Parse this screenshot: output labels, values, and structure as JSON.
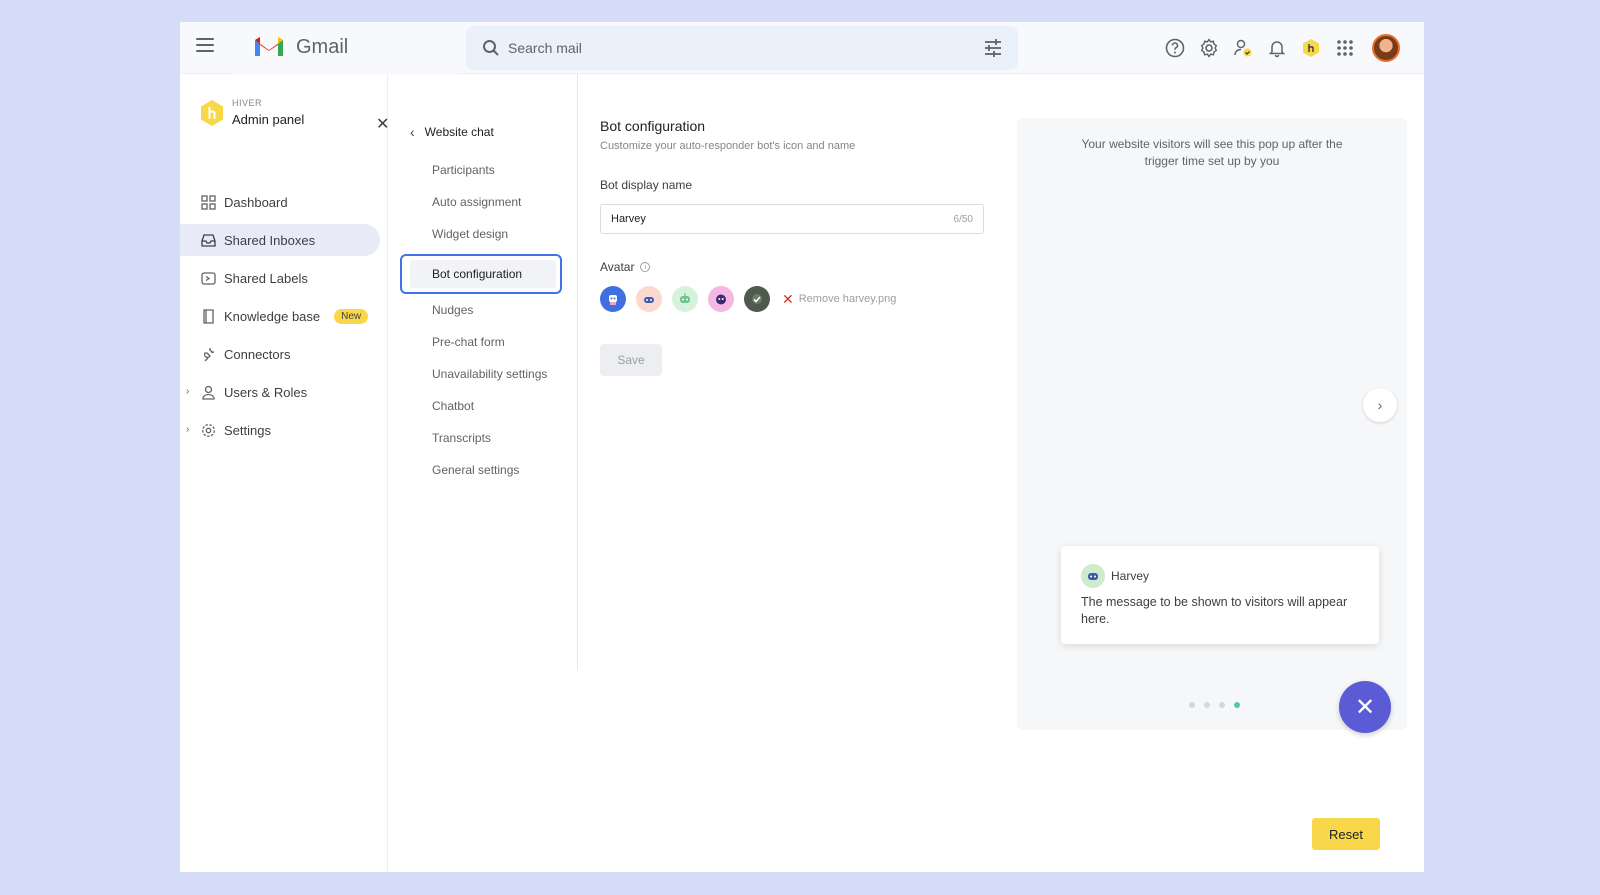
{
  "topbar": {
    "app_name": "Gmail",
    "search_placeholder": "Search mail"
  },
  "sidebar": {
    "brand_label": "HIVER",
    "title": "Admin panel",
    "items": [
      {
        "label": "Dashboard",
        "icon": "grid-icon"
      },
      {
        "label": "Shared Inboxes",
        "icon": "inbox-icon",
        "active": true
      },
      {
        "label": "Shared Labels",
        "icon": "label-icon"
      },
      {
        "label": "Knowledge base",
        "icon": "book-icon",
        "badge": "New"
      },
      {
        "label": "Connectors",
        "icon": "plug-icon"
      },
      {
        "label": "Users & Roles",
        "icon": "person-icon",
        "expandable": true
      },
      {
        "label": "Settings",
        "icon": "gear-icon",
        "expandable": true
      }
    ]
  },
  "subnav": {
    "back_label": "Website chat",
    "items": [
      {
        "label": "Participants"
      },
      {
        "label": "Auto assignment"
      },
      {
        "label": "Widget design"
      },
      {
        "label": "Bot configuration",
        "active": true
      },
      {
        "label": "Nudges"
      },
      {
        "label": "Pre-chat form"
      },
      {
        "label": "Unavailability settings"
      },
      {
        "label": "Chatbot"
      },
      {
        "label": "Transcripts"
      },
      {
        "label": "General settings"
      }
    ]
  },
  "main": {
    "title": "Bot configuration",
    "subtitle": "Customize your auto-responder bot's icon and name",
    "display_name_label": "Bot display name",
    "display_name_value": "Harvey",
    "display_name_count": "6/50",
    "avatar_label": "Avatar",
    "remove_label": "Remove harvey.png",
    "save_label": "Save"
  },
  "preview": {
    "info_text": "Your website visitors will see this pop up after the trigger time set up by you",
    "bot_name": "Harvey",
    "message": "The message to be shown to visitors will appear here.",
    "active_dot": 4,
    "total_dots": 4
  },
  "reset_label": "Reset",
  "colors": {
    "accent": "#3e73ea",
    "fab": "#5b5bd6",
    "reset": "#f8d84a",
    "badge": "#f8d84a"
  }
}
